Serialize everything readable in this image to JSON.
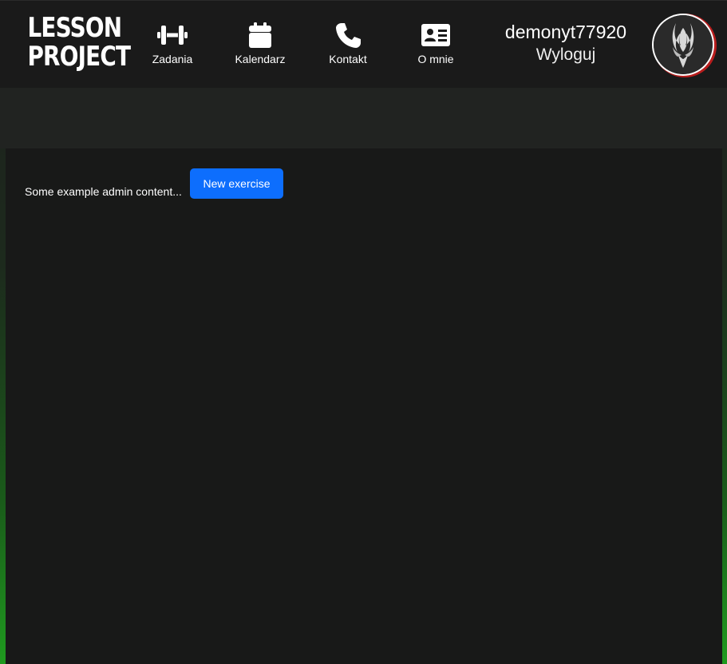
{
  "header": {
    "logo": {
      "line1": "LESSON",
      "line2": "PROJECT"
    },
    "nav": [
      {
        "label": "Zadania",
        "icon": "dumbbell-icon"
      },
      {
        "label": "Kalendarz",
        "icon": "calendar-icon"
      },
      {
        "label": "Kontakt",
        "icon": "phone-icon"
      },
      {
        "label": "O mnie",
        "icon": "id-card-icon"
      }
    ],
    "user": {
      "username": "demonyt77920",
      "logout_label": "Wyloguj",
      "avatar_icon": "tribal-demon-avatar"
    }
  },
  "main": {
    "admin_text": "Some example admin content...",
    "new_exercise_label": "New exercise"
  },
  "colors": {
    "header_bg": "#1a1a1a",
    "panel_bg": "#181918",
    "button_primary": "#0d6efd",
    "avatar_ring": "#b81d1d",
    "background_glow": "#1f9a1f"
  }
}
